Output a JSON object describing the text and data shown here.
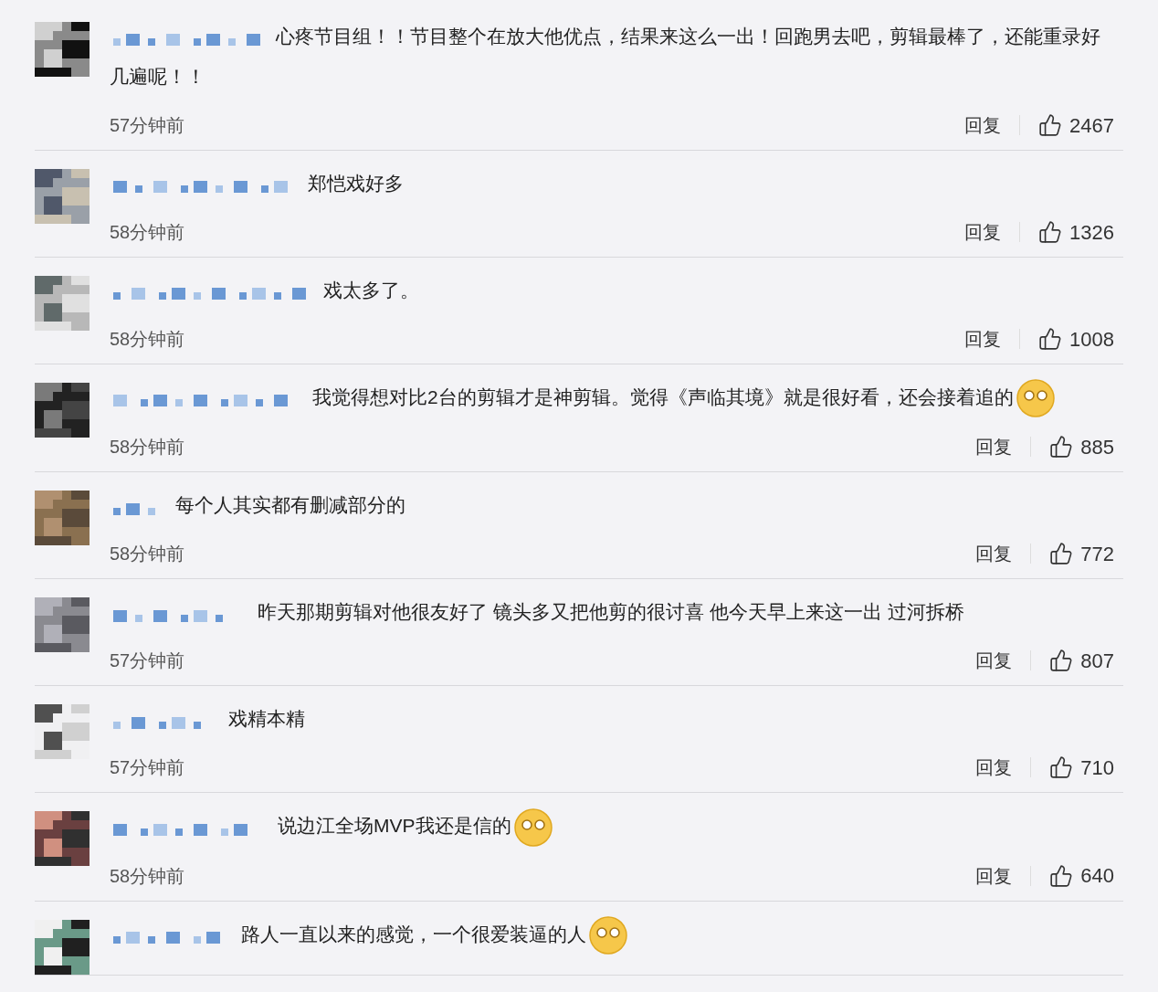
{
  "comments": [
    {
      "text": "心疼节目组！！节目整个在放大他优点，结果来这么一出！回跑男去吧，剪辑最棒了，还能重录好几遍呢！！",
      "emoji": false,
      "time": "57分钟前",
      "reply": "回复",
      "likes": "2467"
    },
    {
      "text": "郑恺戏好多",
      "emoji": false,
      "time": "58分钟前",
      "reply": "回复",
      "likes": "1326"
    },
    {
      "text": "戏太多了。",
      "emoji": false,
      "time": "58分钟前",
      "reply": "回复",
      "likes": "1008"
    },
    {
      "text": "我觉得想对比2台的剪辑才是神剪辑。觉得《声临其境》就是很好看，还会接着追的",
      "emoji": true,
      "time": "58分钟前",
      "reply": "回复",
      "likes": "885"
    },
    {
      "text": "每个人其实都有删减部分的",
      "emoji": false,
      "time": "58分钟前",
      "reply": "回复",
      "likes": "772"
    },
    {
      "text": "昨天那期剪辑对他很友好了 镜头多又把他剪的很讨喜 他今天早上来这一出 过河拆桥",
      "emoji": false,
      "time": "57分钟前",
      "reply": "回复",
      "likes": "807"
    },
    {
      "text": "戏精本精",
      "emoji": false,
      "time": "57分钟前",
      "reply": "回复",
      "likes": "710"
    },
    {
      "text": "说边江全场MVP我还是信的",
      "emoji": true,
      "time": "58分钟前",
      "reply": "回复",
      "likes": "640"
    },
    {
      "text": "路人一直以来的感觉，一个很爱装逼的人",
      "emoji": true
    }
  ]
}
